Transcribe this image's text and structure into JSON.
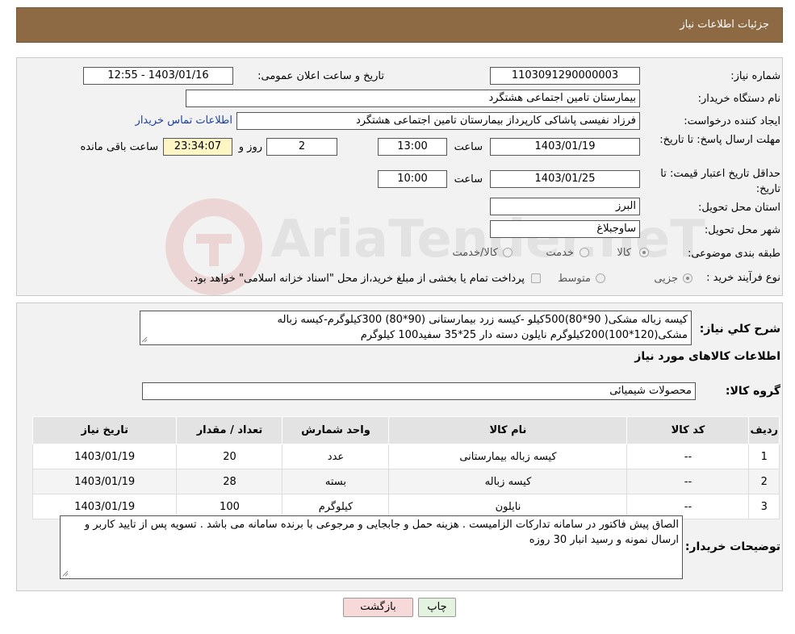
{
  "header": {
    "title": "جزئیات اطلاعات نیاز"
  },
  "form": {
    "need_number_label": "شماره نیاز:",
    "need_number": "1103091290000003",
    "announce_label": "تاریخ و ساعت اعلان عمومی:",
    "announce_value": "1403/01/16 - 12:55",
    "buyer_org_label": "نام دستگاه خریدار:",
    "buyer_org": "بیمارستان تامین اجتماعی هشتگرد",
    "creator_label": "ایجاد کننده درخواست:",
    "creator": "فرزاد  نفیسی پاشاکی کارپرداز بیمارستان تامین اجتماعی هشتگرد",
    "contact_link": "اطلاعات تماس خریدار",
    "deadline_label": "مهلت ارسال پاسخ: تا تاریخ:",
    "deadline_date": "1403/01/19",
    "time_label": "ساعت",
    "deadline_time": "13:00",
    "days_value": "2",
    "days_label": "روز و",
    "remaining_value": "23:34:07",
    "remaining_label": "ساعت باقی مانده",
    "validity_label": "حداقل تاریخ اعتبار قیمت: تا تاریخ:",
    "validity_date": "1403/01/25",
    "validity_time": "10:00",
    "province_label": "استان محل تحویل:",
    "province": "البرز",
    "city_label": "شهر محل تحویل:",
    "city": "ساوجبلاغ",
    "category_label": "طبقه بندی موضوعی:",
    "category_options": [
      "کالا",
      "خدمت",
      "کالا/خدمت"
    ],
    "process_label": "نوع فرآیند خرید :",
    "process_options": [
      "جزیی",
      "متوسط"
    ],
    "process_note": "پرداخت تمام یا بخشی از مبلغ خرید،از محل \"اسناد خزانه اسلامی\" خواهد بود."
  },
  "summary": {
    "label": "شرح کلي نياز:",
    "text": "کیسه زباله مشکی( 90*80)500کیلو -کیسه زرد بیمارستانی (90*80) 300کیلوگرم-کیسه زباله مشکی(120*100)200کیلوگرم نایلون دسته دار 25*35 سفید100 کیلوگرم",
    "goods_info_title": "اطلاعات کالاهای مورد نیاز",
    "group_label": "گروه کالا:",
    "group_value": "محصولات شیمیائی"
  },
  "table": {
    "headers": [
      "ردیف",
      "کد کالا",
      "نام کالا",
      "واحد شمارش",
      "تعداد / مقدار",
      "تاریخ نیاز"
    ],
    "rows": [
      [
        "1",
        "--",
        "کیسه زباله بیمارستانی",
        "عدد",
        "20",
        "1403/01/19"
      ],
      [
        "2",
        "--",
        "کیسه زباله",
        "بسته",
        "28",
        "1403/01/19"
      ],
      [
        "3",
        "--",
        "نایلون",
        "کیلوگرم",
        "100",
        "1403/01/19"
      ]
    ]
  },
  "buyer_notes": {
    "label": "توضیحات خریدار:",
    "text": "الصاق پیش فاکتور در سامانه تدارکات الزامیست . هزینه حمل و جابجایی و مرجوعی با برنده سامانه می باشد . تسویه پس از تایید کاربر و ارسال نمونه و رسید انبار 30 روزه"
  },
  "buttons": {
    "print": "چاپ",
    "back": "بازگشت"
  },
  "watermark": "AriaTender.neT",
  "colors": {
    "header_bg": "#8e6a44",
    "back_button_bg": "#f7d9d9",
    "print_button_bg": "#e3f3df",
    "link": "#1b3f9e"
  }
}
